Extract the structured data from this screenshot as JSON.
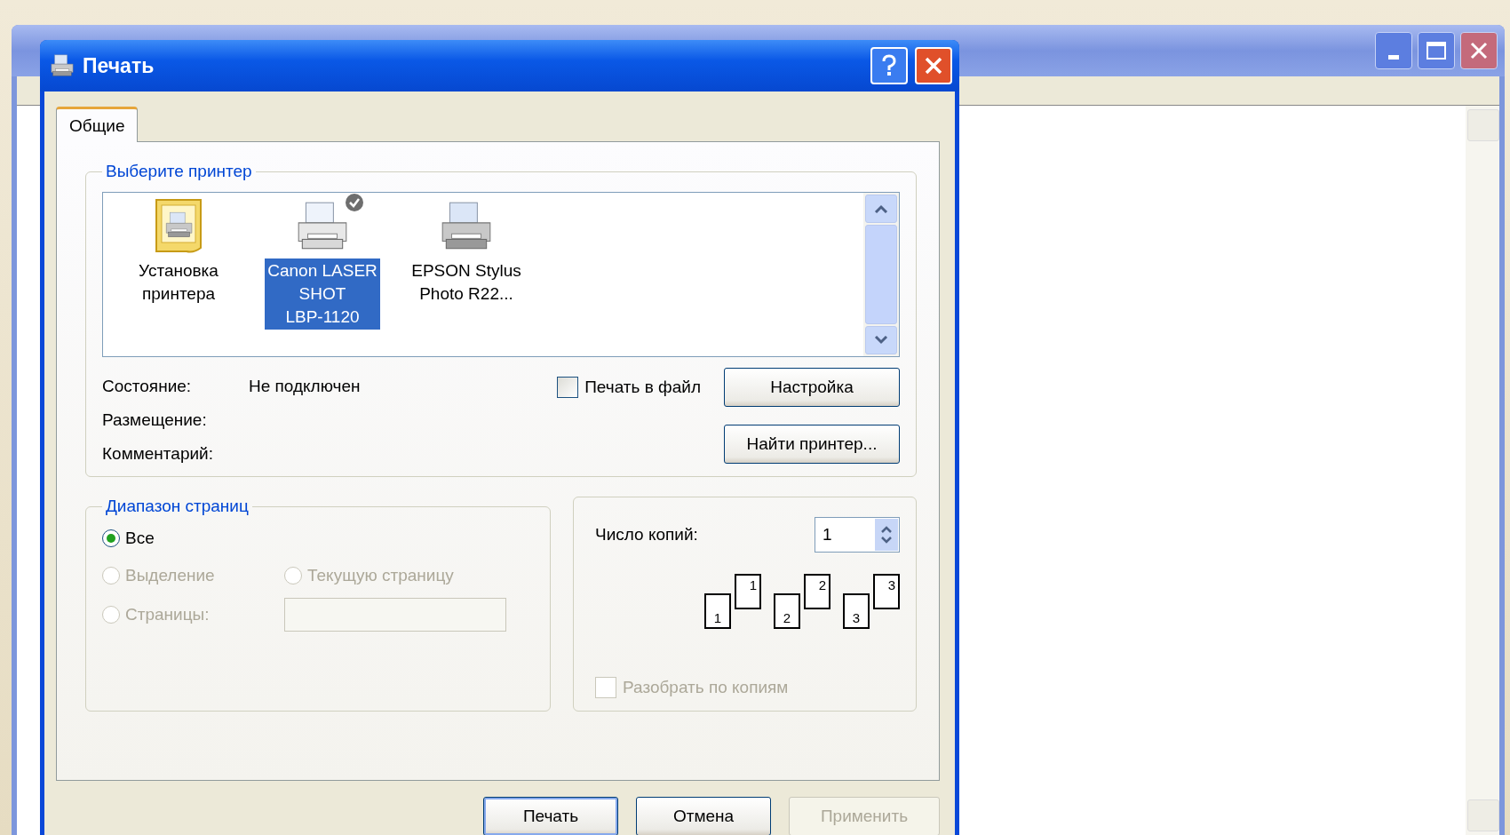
{
  "dialog": {
    "title": "Печать",
    "tabs": [
      {
        "label": "Общие",
        "selected": true
      }
    ],
    "printer_group": {
      "title": "Выберите принтер",
      "printers": [
        {
          "kind": "add",
          "name_lines": [
            "Установка",
            "принтера"
          ],
          "selected": false,
          "default": false
        },
        {
          "kind": "printer",
          "name_lines": [
            "Canon LASER",
            "SHOT",
            "LBP-1120"
          ],
          "selected": true,
          "default": true
        },
        {
          "kind": "printer",
          "name_lines": [
            "EPSON Stylus",
            "Photo R22..."
          ],
          "selected": false,
          "default": false
        }
      ],
      "info": [
        {
          "label": "Состояние:",
          "value": "Не подключен"
        },
        {
          "label": "Размещение:"
        },
        {
          "label": "Комментарий:"
        }
      ],
      "print_to_file": {
        "label": "Печать в файл",
        "checked": false
      },
      "buttons": [
        "Настройка",
        "Найти принтер..."
      ]
    },
    "range_group": {
      "title": "Диапазон страниц",
      "options": [
        {
          "label": "Все",
          "selected": true,
          "disabled": false
        },
        {
          "label": "Выделение",
          "selected": false,
          "disabled": true
        },
        {
          "label": "Текущую страницу",
          "selected": false,
          "disabled": true
        },
        {
          "label": "Страницы:",
          "selected": false,
          "disabled": true
        }
      ],
      "pages_field": {
        "disabled": true
      }
    },
    "copies_group": {
      "label": "Число копий:",
      "value": "1",
      "collate_pages": [
        {
          "back": "1",
          "front": "1"
        },
        {
          "back": "2",
          "front": "2"
        },
        {
          "back": "3",
          "front": "3"
        }
      ],
      "collate": {
        "label": "Разобрать по копиям",
        "checked": false,
        "disabled": true
      }
    },
    "buttons": [
      {
        "label": "Печать",
        "default": true,
        "disabled": false
      },
      {
        "label": "Отмена",
        "default": false,
        "disabled": false
      },
      {
        "label": "Применить",
        "default": false,
        "disabled": true
      }
    ]
  }
}
